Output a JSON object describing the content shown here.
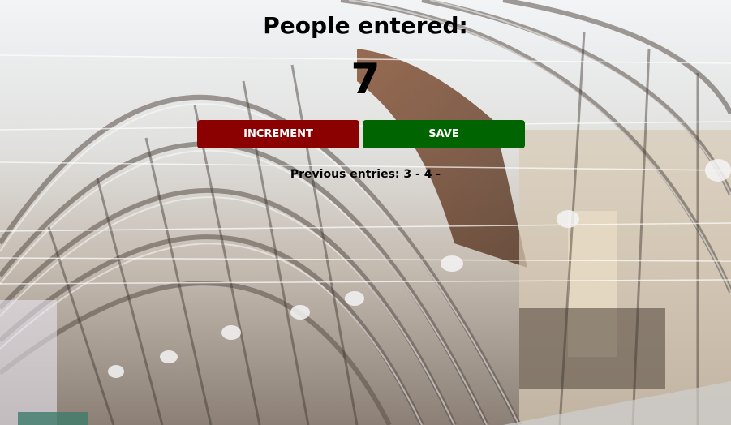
{
  "page": {
    "title": "People entered:",
    "count": "7",
    "buttons": {
      "increment_label": "INCREMENT",
      "save_label": "SAVE"
    },
    "previous_entries": "Previous entries: 3 - 4 -"
  },
  "colors": {
    "increment_button": "#8b0000",
    "save_button": "#006400",
    "text": "#000000"
  }
}
